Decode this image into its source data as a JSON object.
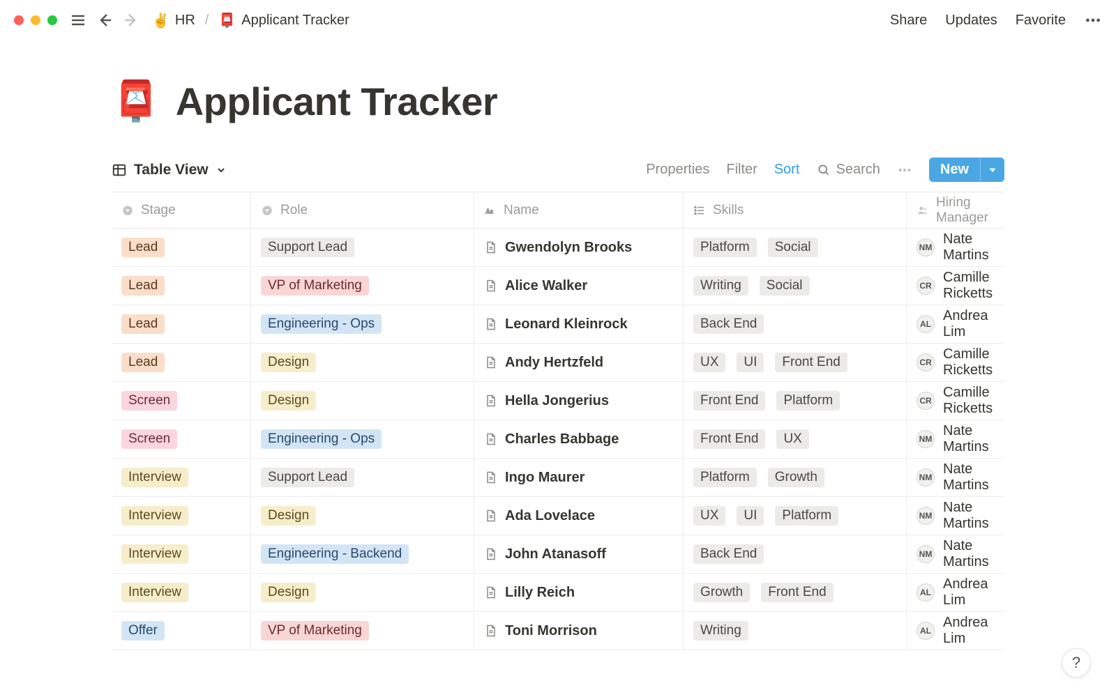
{
  "breadcrumb": {
    "parent_emoji": "✌️",
    "parent_label": "HR",
    "sep": "/",
    "current_emoji": "📮",
    "current_label": "Applicant Tracker"
  },
  "top_actions": {
    "share": "Share",
    "updates": "Updates",
    "favorite": "Favorite"
  },
  "page": {
    "emoji": "📮",
    "title": "Applicant Tracker"
  },
  "view": {
    "name": "Table View"
  },
  "db_actions": {
    "properties": "Properties",
    "filter": "Filter",
    "sort": "Sort",
    "search": "Search",
    "new": "New"
  },
  "columns": {
    "stage": "Stage",
    "role": "Role",
    "name": "Name",
    "skills": "Skills",
    "manager": "Hiring Manager"
  },
  "tag_colors": {
    "Lead": "orange",
    "Screen": "pink",
    "Interview": "yellow",
    "Offer": "blue",
    "Support Lead": "gray",
    "VP of Marketing": "red",
    "Engineering - Ops": "blue",
    "Engineering - Backend": "blue",
    "Design": "yellow",
    "Platform": "gray",
    "Social": "gray",
    "Writing": "gray",
    "Back End": "gray",
    "UX": "gray",
    "UI": "gray",
    "Front End": "gray",
    "Growth": "gray"
  },
  "rows": [
    {
      "stage": "Lead",
      "role": "Support Lead",
      "name": "Gwendolyn Brooks",
      "skills": [
        "Platform",
        "Social"
      ],
      "manager": "Nate Martins"
    },
    {
      "stage": "Lead",
      "role": "VP of Marketing",
      "name": "Alice Walker",
      "skills": [
        "Writing",
        "Social"
      ],
      "manager": "Camille Ricketts"
    },
    {
      "stage": "Lead",
      "role": "Engineering - Ops",
      "name": "Leonard Kleinrock",
      "skills": [
        "Back End"
      ],
      "manager": "Andrea Lim"
    },
    {
      "stage": "Lead",
      "role": "Design",
      "name": "Andy Hertzfeld",
      "skills": [
        "UX",
        "UI",
        "Front End"
      ],
      "manager": "Camille Ricketts"
    },
    {
      "stage": "Screen",
      "role": "Design",
      "name": "Hella Jongerius",
      "skills": [
        "Front End",
        "Platform"
      ],
      "manager": "Camille Ricketts"
    },
    {
      "stage": "Screen",
      "role": "Engineering - Ops",
      "name": "Charles Babbage",
      "skills": [
        "Front End",
        "UX"
      ],
      "manager": "Nate Martins"
    },
    {
      "stage": "Interview",
      "role": "Support Lead",
      "name": "Ingo Maurer",
      "skills": [
        "Platform",
        "Growth"
      ],
      "manager": "Nate Martins"
    },
    {
      "stage": "Interview",
      "role": "Design",
      "name": "Ada Lovelace",
      "skills": [
        "UX",
        "UI",
        "Platform"
      ],
      "manager": "Nate Martins"
    },
    {
      "stage": "Interview",
      "role": "Engineering - Backend",
      "name": "John Atanasoff",
      "skills": [
        "Back End"
      ],
      "manager": "Nate Martins"
    },
    {
      "stage": "Interview",
      "role": "Design",
      "name": "Lilly Reich",
      "skills": [
        "Growth",
        "Front End"
      ],
      "manager": "Andrea Lim"
    },
    {
      "stage": "Offer",
      "role": "VP of Marketing",
      "name": "Toni Morrison",
      "skills": [
        "Writing"
      ],
      "manager": "Andrea Lim"
    }
  ],
  "help": "?"
}
